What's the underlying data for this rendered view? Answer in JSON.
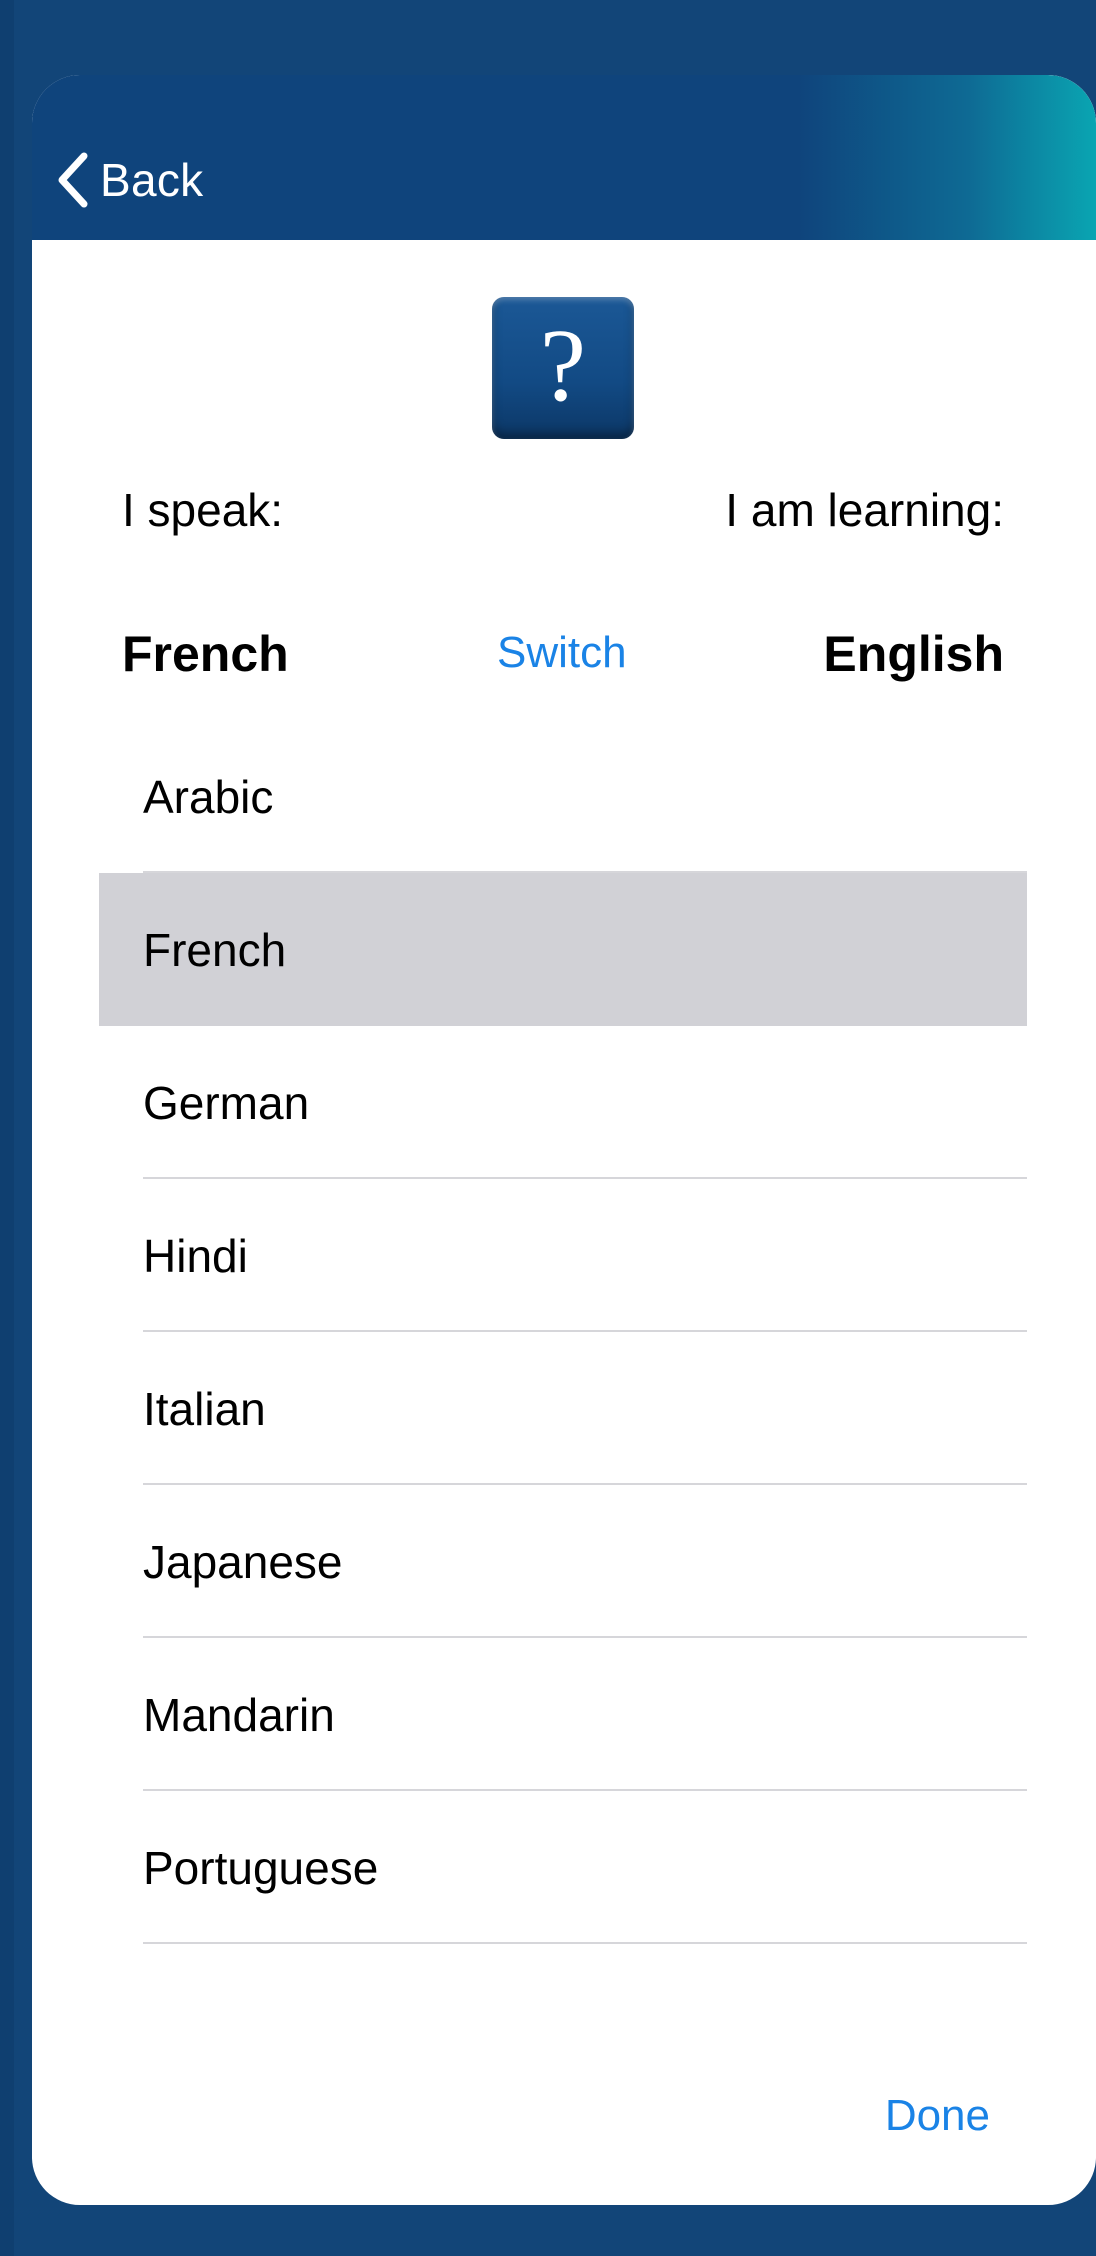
{
  "nav": {
    "back_label": "Back"
  },
  "help_button": {
    "icon": "question-mark-icon",
    "glyph": "?"
  },
  "labels": {
    "i_speak": "I speak:",
    "i_am_learning": "I am learning:"
  },
  "selection": {
    "native_language": "French",
    "switch_label": "Switch",
    "target_language": "English"
  },
  "languages": [
    {
      "label": "Arabic",
      "selected": false
    },
    {
      "label": "French",
      "selected": true
    },
    {
      "label": "German",
      "selected": false
    },
    {
      "label": "Hindi",
      "selected": false
    },
    {
      "label": "Italian",
      "selected": false
    },
    {
      "label": "Japanese",
      "selected": false
    },
    {
      "label": "Mandarin",
      "selected": false
    },
    {
      "label": "Portuguese",
      "selected": false
    }
  ],
  "done_label": "Done",
  "colors": {
    "background": "#124578",
    "nav_bar": "#0f447c",
    "nav_gradient_end": "#0aa5b2",
    "accent_link": "#1a83e6",
    "selected_row": "#d1d1d6",
    "separator": "#d6d6da"
  }
}
